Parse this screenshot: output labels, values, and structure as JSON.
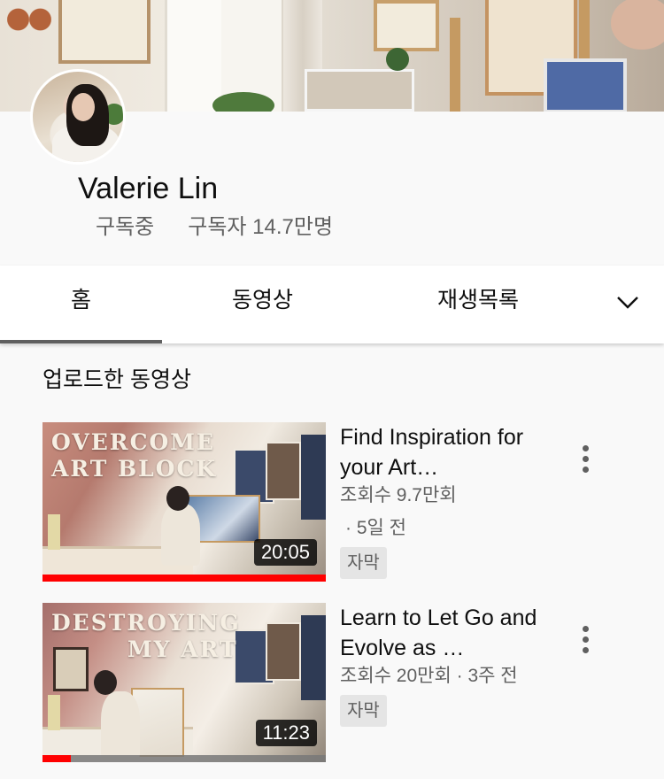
{
  "channel": {
    "name": "Valerie Lin",
    "subscribe_status": "구독중",
    "subscriber_count": "구독자 14.7만명"
  },
  "tabs": [
    {
      "label": "홈",
      "selected": true
    },
    {
      "label": "동영상",
      "selected": false
    },
    {
      "label": "재생목록",
      "selected": false
    }
  ],
  "tabs_more_icon": "chevron-down-icon",
  "section": {
    "title": "업로드한 동영상"
  },
  "videos": [
    {
      "thumbnail_text_line1": "OVERCOME",
      "thumbnail_text_line2": "ART BLOCK",
      "title": "Find Inspiration for your Art…",
      "views": "조회수 9.7만회",
      "age": "· 5일 전",
      "badge": "자막",
      "duration": "20:05",
      "watched_fraction": 1.0
    },
    {
      "thumbnail_text_line1": "DESTROYING",
      "thumbnail_text_line2": "MY ART",
      "title": "Learn to Let Go and Evolve as …",
      "views": "조회수 20만회",
      "age": "· 3주 전",
      "badge": "자막",
      "duration": "11:23",
      "watched_fraction": 0.1
    }
  ],
  "colors": {
    "progress": "#ff0000",
    "tab_indicator": "#606060",
    "secondary_text": "#606060"
  }
}
